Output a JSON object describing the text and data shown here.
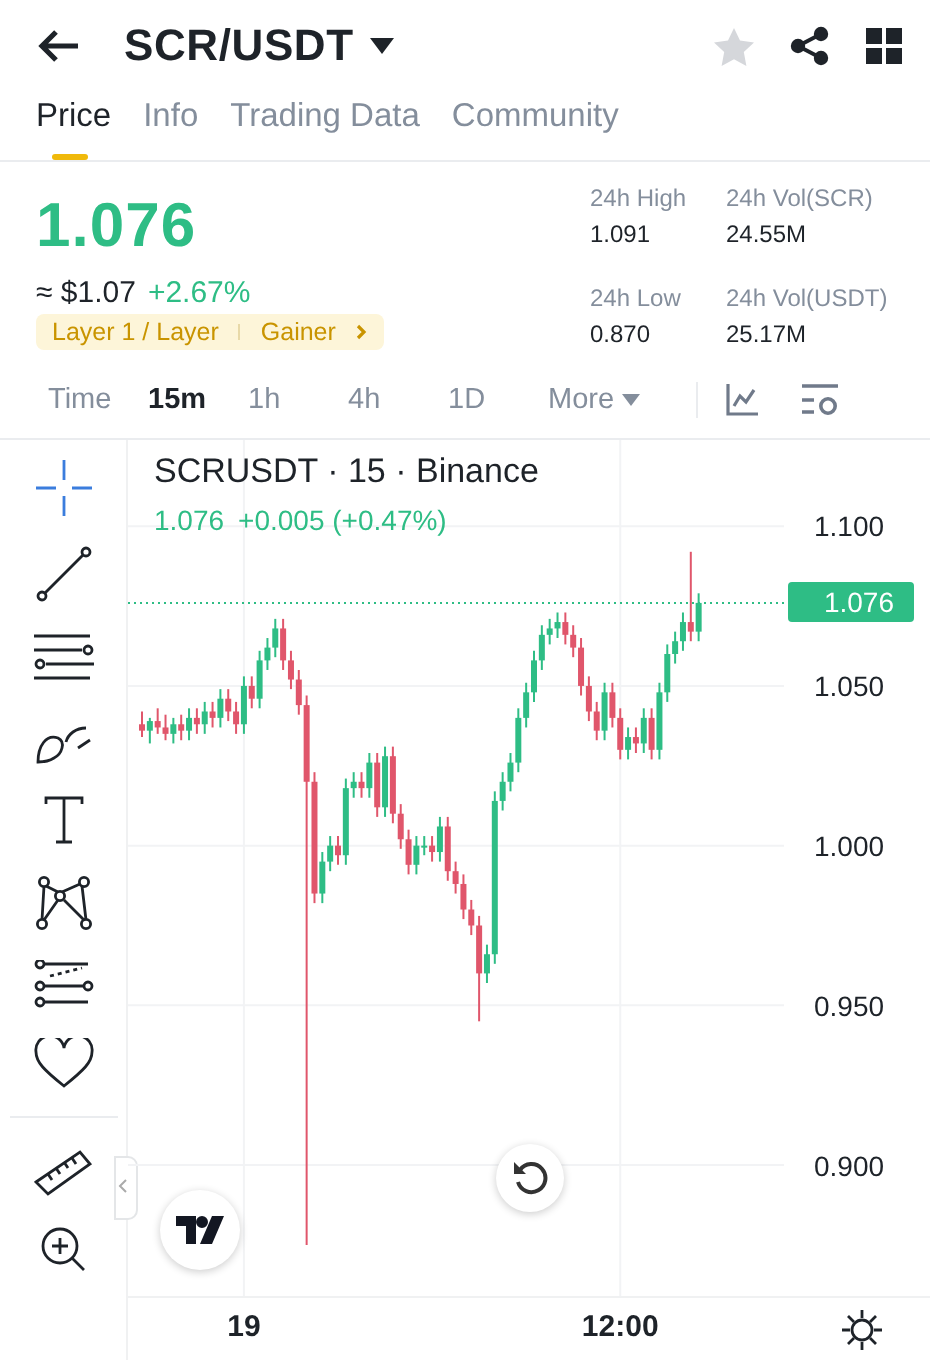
{
  "header": {
    "title": "SCR/USDT",
    "favorite": false
  },
  "tabs": [
    {
      "label": "Price",
      "selected": true
    },
    {
      "label": "Info",
      "selected": false
    },
    {
      "label": "Trading Data",
      "selected": false
    },
    {
      "label": "Community",
      "selected": false
    }
  ],
  "price": {
    "last": "1.076",
    "fiat": "≈ $1.07",
    "change": "+2.67%",
    "tags": [
      "Layer 1 / Layer",
      "Gainer"
    ]
  },
  "stats": [
    {
      "label": "24h High",
      "value": "1.091"
    },
    {
      "label": "24h Vol(SCR)",
      "value": "24.55M"
    },
    {
      "label": "24h Low",
      "value": "0.870"
    },
    {
      "label": "24h Vol(USDT)",
      "value": "25.17M"
    }
  ],
  "intervals": [
    {
      "label": "Time",
      "selected": false
    },
    {
      "label": "15m",
      "selected": true
    },
    {
      "label": "1h",
      "selected": false
    },
    {
      "label": "4h",
      "selected": false
    },
    {
      "label": "1D",
      "selected": false
    }
  ],
  "more": "More",
  "chart": {
    "title": "SCRUSDT · 15 · Binance",
    "last": "1.076",
    "change": "+0.005 (+0.47%)",
    "chart_data": {
      "type": "candlestick",
      "categories": [
        null,
        null,
        null,
        null,
        null,
        null,
        null,
        null,
        null,
        null,
        null,
        null,
        null,
        "19",
        null,
        null,
        null,
        null,
        null,
        null,
        null,
        null,
        null,
        null,
        null,
        null,
        null,
        null,
        null,
        null,
        null,
        null,
        null,
        null,
        null,
        null,
        null,
        null,
        null,
        null,
        null,
        null,
        null,
        null,
        null,
        null,
        null,
        null,
        null,
        null,
        null,
        null,
        null,
        null,
        null,
        null,
        null,
        null,
        null,
        null,
        null,
        "12:00",
        null,
        null,
        null,
        null,
        null,
        null,
        null,
        null,
        null,
        null
      ],
      "ohlc": [
        [
          1.038,
          1.042,
          1.034,
          1.036
        ],
        [
          1.036,
          1.04,
          1.032,
          1.039
        ],
        [
          1.039,
          1.043,
          1.035,
          1.037
        ],
        [
          1.037,
          1.041,
          1.033,
          1.035
        ],
        [
          1.035,
          1.04,
          1.032,
          1.038
        ],
        [
          1.038,
          1.041,
          1.033,
          1.036
        ],
        [
          1.036,
          1.043,
          1.033,
          1.04
        ],
        [
          1.04,
          1.043,
          1.035,
          1.038
        ],
        [
          1.038,
          1.045,
          1.035,
          1.042
        ],
        [
          1.042,
          1.045,
          1.037,
          1.04
        ],
        [
          1.04,
          1.049,
          1.037,
          1.046
        ],
        [
          1.046,
          1.049,
          1.039,
          1.042
        ],
        [
          1.042,
          1.045,
          1.035,
          1.038
        ],
        [
          1.038,
          1.053,
          1.035,
          1.05
        ],
        [
          1.05,
          1.053,
          1.043,
          1.046
        ],
        [
          1.046,
          1.061,
          1.043,
          1.058
        ],
        [
          1.058,
          1.065,
          1.055,
          1.062
        ],
        [
          1.062,
          1.071,
          1.059,
          1.068
        ],
        [
          1.068,
          1.071,
          1.055,
          1.058
        ],
        [
          1.058,
          1.061,
          1.049,
          1.052
        ],
        [
          1.052,
          1.055,
          1.041,
          1.044
        ],
        [
          1.044,
          1.047,
          0.875,
          1.02
        ],
        [
          1.02,
          1.023,
          0.982,
          0.985
        ],
        [
          0.985,
          0.998,
          0.982,
          0.995
        ],
        [
          0.995,
          1.003,
          0.992,
          1.0
        ],
        [
          1.0,
          1.003,
          0.994,
          0.997
        ],
        [
          0.997,
          1.021,
          0.994,
          1.018
        ],
        [
          1.018,
          1.023,
          1.015,
          1.02
        ],
        [
          1.02,
          1.023,
          1.015,
          1.018
        ],
        [
          1.018,
          1.029,
          1.015,
          1.026
        ],
        [
          1.026,
          1.029,
          1.009,
          1.012
        ],
        [
          1.012,
          1.031,
          1.009,
          1.028
        ],
        [
          1.028,
          1.031,
          1.007,
          1.01
        ],
        [
          1.01,
          1.013,
          0.999,
          1.002
        ],
        [
          1.002,
          1.005,
          0.991,
          0.994
        ],
        [
          0.994,
          1.003,
          0.991,
          1.0
        ],
        [
          1.0,
          1.003,
          0.997,
          1.0
        ],
        [
          1.0,
          1.003,
          0.995,
          0.998
        ],
        [
          0.998,
          1.009,
          0.995,
          1.006
        ],
        [
          1.006,
          1.009,
          0.989,
          0.992
        ],
        [
          0.992,
          0.995,
          0.985,
          0.988
        ],
        [
          0.988,
          0.991,
          0.977,
          0.98
        ],
        [
          0.98,
          0.983,
          0.972,
          0.975
        ],
        [
          0.975,
          0.978,
          0.945,
          0.96
        ],
        [
          0.96,
          0.969,
          0.957,
          0.966
        ],
        [
          0.966,
          1.017,
          0.963,
          1.014
        ],
        [
          1.014,
          1.023,
          1.011,
          1.02
        ],
        [
          1.02,
          1.029,
          1.017,
          1.026
        ],
        [
          1.026,
          1.043,
          1.023,
          1.04
        ],
        [
          1.04,
          1.051,
          1.037,
          1.048
        ],
        [
          1.048,
          1.061,
          1.045,
          1.058
        ],
        [
          1.058,
          1.069,
          1.055,
          1.066
        ],
        [
          1.066,
          1.071,
          1.063,
          1.068
        ],
        [
          1.068,
          1.073,
          1.065,
          1.07
        ],
        [
          1.07,
          1.073,
          1.063,
          1.066
        ],
        [
          1.066,
          1.069,
          1.059,
          1.062
        ],
        [
          1.062,
          1.065,
          1.047,
          1.05
        ],
        [
          1.05,
          1.053,
          1.039,
          1.042
        ],
        [
          1.042,
          1.045,
          1.033,
          1.036
        ],
        [
          1.036,
          1.051,
          1.033,
          1.048
        ],
        [
          1.048,
          1.051,
          1.037,
          1.04
        ],
        [
          1.04,
          1.043,
          1.027,
          1.03
        ],
        [
          1.03,
          1.037,
          1.027,
          1.034
        ],
        [
          1.034,
          1.037,
          1.029,
          1.032
        ],
        [
          1.032,
          1.043,
          1.029,
          1.04
        ],
        [
          1.04,
          1.043,
          1.027,
          1.03
        ],
        [
          1.03,
          1.051,
          1.027,
          1.048
        ],
        [
          1.048,
          1.063,
          1.045,
          1.06
        ],
        [
          1.06,
          1.067,
          1.057,
          1.064
        ],
        [
          1.064,
          1.073,
          1.061,
          1.07
        ],
        [
          1.07,
          1.092,
          1.064,
          1.067
        ],
        [
          1.067,
          1.079,
          1.064,
          1.076
        ]
      ],
      "ylim": [
        0.859,
        1.127
      ],
      "grid": true,
      "ref_lines": [
        {
          "axis": "y",
          "value": 1.076,
          "label": "1.076",
          "color": "#2ebd85"
        }
      ],
      "yticks": [
        {
          "value": 1.1,
          "label": "1.100"
        },
        {
          "value": 1.05,
          "label": "1.050"
        },
        {
          "value": 1.0,
          "label": "1.000"
        },
        {
          "value": 0.95,
          "label": "0.950"
        },
        {
          "value": 0.9,
          "label": "0.900"
        }
      ]
    }
  }
}
